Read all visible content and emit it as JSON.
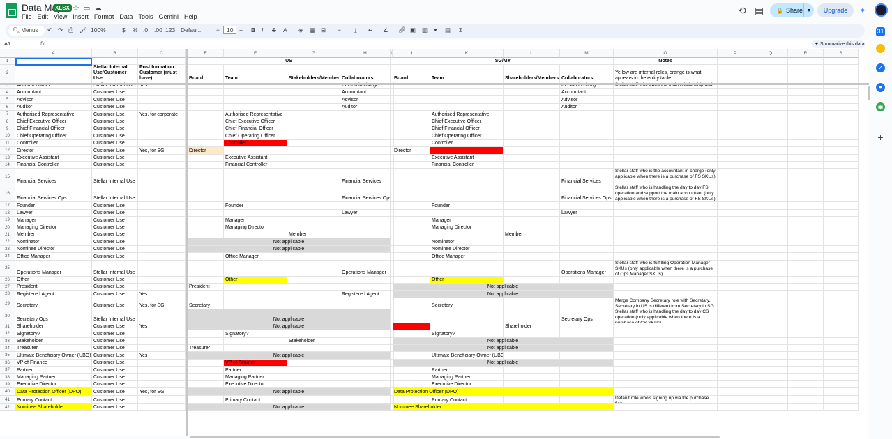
{
  "app": {
    "title": "Data Map",
    "format_badge": "XLSX",
    "menu": [
      "File",
      "Edit",
      "View",
      "Insert",
      "Format",
      "Data",
      "Tools",
      "Gemini",
      "Help"
    ],
    "share_label": "Share",
    "upgrade_label": "Upgrade"
  },
  "toolbar": {
    "menus_label": "Menus",
    "zoom": "100%",
    "currency": "$",
    "percent": "%",
    "dec_dec": ".0",
    "inc_dec": ".00",
    "num_fmt": "123",
    "font": "Defaul...",
    "font_size": "10"
  },
  "formula_bar": {
    "cell_ref": "A1",
    "fx": "fx",
    "summarize_label": "Summarize this data"
  },
  "colors": {
    "red": "#ff0000",
    "yellow": "#ffff00",
    "gray": "#d9d9d9",
    "peach": "#fde9c6",
    "selection": "#1a73e8"
  },
  "columns": [
    "A",
    "B",
    "C",
    "E",
    "F",
    "G",
    "H",
    "I",
    "J",
    "K",
    "L",
    "M",
    "O",
    "P",
    "Q",
    "R",
    "S"
  ],
  "row_numbers": [
    "1",
    "2",
    "3",
    "4",
    "5",
    "6",
    "7",
    "8",
    "9",
    "10",
    "11",
    "12",
    "13",
    "14",
    "15",
    "16",
    "17",
    "18",
    "19",
    "20",
    "21",
    "22",
    "23",
    "24",
    "25",
    "26",
    "27",
    "28",
    "29",
    "30",
    "31",
    "32",
    "33",
    "34",
    "35",
    "36",
    "37",
    "38",
    "39",
    "40",
    "41",
    "42"
  ],
  "headers": {
    "us": "US",
    "sgmy": "SG/MY",
    "notes": "Notes",
    "b2": "Stellar Internal Use/Customer Use",
    "c2": "Post formation Customer (must have)",
    "us_board": "Board",
    "us_team": "Team",
    "us_stake": "Stakeholders/Members",
    "us_collab": "Collaborators",
    "sg_board": "Board",
    "sg_team": "Team",
    "sg_share": "Shareholders/Members",
    "sg_collab": "Collaborators",
    "notes_legend": "Yellow are internal roles, orange is what appears in the entity table"
  },
  "cells": [
    {
      "r": 3,
      "c": "A",
      "t": "Account Owner"
    },
    {
      "r": 3,
      "c": "B",
      "t": "Stellar Internal Use"
    },
    {
      "r": 3,
      "c": "C",
      "t": "Yes"
    },
    {
      "r": 3,
      "c": "H",
      "t": "Person in charge"
    },
    {
      "r": 3,
      "c": "M",
      "t": "Person in charge"
    },
    {
      "r": 3,
      "c": "O",
      "t": "Stellar staff who owns the main relationship and interfaces with the customer",
      "w": 1
    },
    {
      "r": 4,
      "c": "A",
      "t": "Accountant"
    },
    {
      "r": 4,
      "c": "B",
      "t": "Customer Use"
    },
    {
      "r": 4,
      "c": "H",
      "t": "Accountant"
    },
    {
      "r": 4,
      "c": "M",
      "t": "Accountant"
    },
    {
      "r": 5,
      "c": "A",
      "t": "Advisor"
    },
    {
      "r": 5,
      "c": "B",
      "t": "Customer Use"
    },
    {
      "r": 5,
      "c": "H",
      "t": "Advisor"
    },
    {
      "r": 5,
      "c": "M",
      "t": "Advisor"
    },
    {
      "r": 6,
      "c": "A",
      "t": "Auditor"
    },
    {
      "r": 6,
      "c": "B",
      "t": "Customer Use"
    },
    {
      "r": 6,
      "c": "H",
      "t": "Auditor"
    },
    {
      "r": 6,
      "c": "M",
      "t": "Auditor"
    },
    {
      "r": 7,
      "c": "A",
      "t": "Authorised Representative"
    },
    {
      "r": 7,
      "c": "B",
      "t": "Customer Use"
    },
    {
      "r": 7,
      "c": "C",
      "t": "Yes, for corporate"
    },
    {
      "r": 7,
      "c": "F",
      "t": "Authorised Representative"
    },
    {
      "r": 7,
      "c": "K",
      "t": "Authorised Representative"
    },
    {
      "r": 8,
      "c": "A",
      "t": "Chief Executive Officer"
    },
    {
      "r": 8,
      "c": "B",
      "t": "Customer Use"
    },
    {
      "r": 8,
      "c": "F",
      "t": "Chief Executive Officer"
    },
    {
      "r": 8,
      "c": "K",
      "t": "Chief Executive Officer"
    },
    {
      "r": 9,
      "c": "A",
      "t": "Chief Financial Officer"
    },
    {
      "r": 9,
      "c": "B",
      "t": "Customer Use"
    },
    {
      "r": 9,
      "c": "F",
      "t": "Chief Financial Officer"
    },
    {
      "r": 9,
      "c": "K",
      "t": "Chief Financial Officer"
    },
    {
      "r": 10,
      "c": "A",
      "t": "Chief Operating Officer"
    },
    {
      "r": 10,
      "c": "B",
      "t": "Customer Use"
    },
    {
      "r": 10,
      "c": "F",
      "t": "Chief Operating Officer"
    },
    {
      "r": 10,
      "c": "K",
      "t": "Chief Operating Officer"
    },
    {
      "r": 11,
      "c": "A",
      "t": "Controller"
    },
    {
      "r": 11,
      "c": "B",
      "t": "Customer Use"
    },
    {
      "r": 11,
      "c": "F",
      "t": "Controller",
      "bg": "red"
    },
    {
      "r": 11,
      "c": "K",
      "t": "Controller"
    },
    {
      "r": 12,
      "c": "A",
      "t": "Director"
    },
    {
      "r": 12,
      "c": "B",
      "t": "Customer Use"
    },
    {
      "r": 12,
      "c": "C",
      "t": "Yes, for SG"
    },
    {
      "r": 12,
      "c": "E",
      "t": "Director",
      "bg": "peach"
    },
    {
      "r": 12,
      "c": "J",
      "t": "Director"
    },
    {
      "r": 12,
      "c": "K",
      "t": "",
      "bg": "red"
    },
    {
      "r": 13,
      "c": "A",
      "t": "Executive Assistant"
    },
    {
      "r": 13,
      "c": "B",
      "t": "Customer Use"
    },
    {
      "r": 13,
      "c": "F",
      "t": "Executive Assistant"
    },
    {
      "r": 13,
      "c": "K",
      "t": "Executive Assistant"
    },
    {
      "r": 14,
      "c": "A",
      "t": "Financial Controller"
    },
    {
      "r": 14,
      "c": "B",
      "t": "Customer Use"
    },
    {
      "r": 14,
      "c": "F",
      "t": "Financial Controller"
    },
    {
      "r": 14,
      "c": "K",
      "t": "Financial Controller"
    },
    {
      "r": 15,
      "c": "A",
      "t": "Financial Services"
    },
    {
      "r": 15,
      "c": "B",
      "t": "Stellar Internal Use"
    },
    {
      "r": 15,
      "c": "H",
      "t": "Financial Services"
    },
    {
      "r": 15,
      "c": "M",
      "t": "Financial Services"
    },
    {
      "r": 15,
      "c": "O",
      "t": "Stellar staff who is the accountant in charge (only applicable when there is a purchase of FS SKUs)",
      "w": 1
    },
    {
      "r": 16,
      "c": "A",
      "t": "Financial Services Ops"
    },
    {
      "r": 16,
      "c": "B",
      "t": "Stellar Internal Use"
    },
    {
      "r": 16,
      "c": "H",
      "t": "Financial Services Ops"
    },
    {
      "r": 16,
      "c": "M",
      "t": "Financial Services Ops"
    },
    {
      "r": 16,
      "c": "O",
      "t": "Stellar staff who is handling the day to day FS operation and support the main accountant (only applicable when there is a purchase of FS SKUs)",
      "w": 1
    },
    {
      "r": 17,
      "c": "A",
      "t": "Founder"
    },
    {
      "r": 17,
      "c": "B",
      "t": "Customer Use"
    },
    {
      "r": 17,
      "c": "F",
      "t": "Founder"
    },
    {
      "r": 17,
      "c": "K",
      "t": "Founder"
    },
    {
      "r": 18,
      "c": "A",
      "t": "Lawyer"
    },
    {
      "r": 18,
      "c": "B",
      "t": "Customer Use"
    },
    {
      "r": 18,
      "c": "H",
      "t": "Lawyer"
    },
    {
      "r": 18,
      "c": "M",
      "t": "Lawyer"
    },
    {
      "r": 19,
      "c": "A",
      "t": "Manager"
    },
    {
      "r": 19,
      "c": "B",
      "t": "Customer Use"
    },
    {
      "r": 19,
      "c": "F",
      "t": "Manager"
    },
    {
      "r": 19,
      "c": "K",
      "t": "Manager"
    },
    {
      "r": 20,
      "c": "A",
      "t": "Managing Director"
    },
    {
      "r": 20,
      "c": "B",
      "t": "Customer Use"
    },
    {
      "r": 20,
      "c": "F",
      "t": "Managing Director"
    },
    {
      "r": 20,
      "c": "K",
      "t": "Managing Director"
    },
    {
      "r": 21,
      "c": "A",
      "t": "Member"
    },
    {
      "r": 21,
      "c": "B",
      "t": "Customer Use"
    },
    {
      "r": 21,
      "c": "G",
      "t": "Member"
    },
    {
      "r": 21,
      "c": "L",
      "t": "Member"
    },
    {
      "r": 22,
      "c": "A",
      "t": "Nominator"
    },
    {
      "r": 22,
      "c": "B",
      "t": "Customer Use"
    },
    {
      "r": 22,
      "c": "E",
      "t": "Not applicable",
      "bg": "gray",
      "span": "EH",
      "ctr": 1
    },
    {
      "r": 22,
      "c": "K",
      "t": "Nominator"
    },
    {
      "r": 23,
      "c": "A",
      "t": "Nominee Director"
    },
    {
      "r": 23,
      "c": "B",
      "t": "Customer Use"
    },
    {
      "r": 23,
      "c": "E",
      "t": "Not applicable",
      "bg": "gray",
      "span": "EH",
      "ctr": 1
    },
    {
      "r": 23,
      "c": "K",
      "t": "Nominee Director"
    },
    {
      "r": 24,
      "c": "A",
      "t": "Office Manager"
    },
    {
      "r": 24,
      "c": "B",
      "t": "Customer Use"
    },
    {
      "r": 24,
      "c": "F",
      "t": "Office Manager"
    },
    {
      "r": 24,
      "c": "K",
      "t": "Office Manager"
    },
    {
      "r": 25,
      "c": "A",
      "t": "Operations Manager"
    },
    {
      "r": 25,
      "c": "B",
      "t": "Stellar Internal Use"
    },
    {
      "r": 25,
      "c": "H",
      "t": "Operations Manager"
    },
    {
      "r": 25,
      "c": "M",
      "t": "Operations Manager"
    },
    {
      "r": 25,
      "c": "O",
      "t": "Stellar staff who is fulfilling Operation Manager SKUs (only applicable when there is a purchase of Ops Manager SKUs)",
      "w": 1
    },
    {
      "r": 26,
      "c": "A",
      "t": "Other"
    },
    {
      "r": 26,
      "c": "B",
      "t": "Customer Use"
    },
    {
      "r": 26,
      "c": "F",
      "t": "Other",
      "bg": "yellow"
    },
    {
      "r": 26,
      "c": "K",
      "t": "Other",
      "bg": "yellow"
    },
    {
      "r": 27,
      "c": "A",
      "t": "President"
    },
    {
      "r": 27,
      "c": "B",
      "t": "Customer Use"
    },
    {
      "r": 27,
      "c": "E",
      "t": "President"
    },
    {
      "r": 27,
      "c": "J",
      "t": "Not applicable",
      "bg": "gray",
      "span": "JM",
      "ctr": 1
    },
    {
      "r": 28,
      "c": "A",
      "t": "Registered Agent"
    },
    {
      "r": 28,
      "c": "B",
      "t": "Customer Use"
    },
    {
      "r": 28,
      "c": "C",
      "t": "Yes"
    },
    {
      "r": 28,
      "c": "H",
      "t": "Registered Agent"
    },
    {
      "r": 28,
      "c": "J",
      "t": "Not applicable",
      "bg": "gray",
      "span": "JM",
      "ctr": 1
    },
    {
      "r": 29,
      "c": "A",
      "t": "Secretary"
    },
    {
      "r": 29,
      "c": "B",
      "t": "Customer Use"
    },
    {
      "r": 29,
      "c": "C",
      "t": "Yes, for SG"
    },
    {
      "r": 29,
      "c": "E",
      "t": "Secretary"
    },
    {
      "r": 29,
      "c": "K",
      "t": "Secretary"
    },
    {
      "r": 29,
      "c": "O",
      "t": "Merge Company Secretary role with Secretary. Secretary in US is different from Secretary in SG",
      "w": 1
    },
    {
      "r": 30,
      "c": "A",
      "t": "Secretary Ops"
    },
    {
      "r": 30,
      "c": "B",
      "t": "Stellar Internal Use"
    },
    {
      "r": 30,
      "c": "E",
      "t": "Not applicable",
      "bg": "gray",
      "span": "EH",
      "ctr": 1
    },
    {
      "r": 30,
      "c": "M",
      "t": "Secretary Ops"
    },
    {
      "r": 30,
      "c": "O",
      "t": "Stellar staff who is handling the day to day CS operation (only applicable when there is a purchase of CS SKUs)",
      "w": 1
    },
    {
      "r": 31,
      "c": "A",
      "t": "Shareholder"
    },
    {
      "r": 31,
      "c": "B",
      "t": "Customer Use"
    },
    {
      "r": 31,
      "c": "C",
      "t": "Yes"
    },
    {
      "r": 31,
      "c": "E",
      "t": "Not applicable",
      "bg": "gray",
      "span": "EH",
      "ctr": 1
    },
    {
      "r": 31,
      "c": "J",
      "t": "",
      "bg": "red"
    },
    {
      "r": 31,
      "c": "L",
      "t": "Shareholder"
    },
    {
      "r": 32,
      "c": "A",
      "t": "Signatory?"
    },
    {
      "r": 32,
      "c": "B",
      "t": "Customer Use"
    },
    {
      "r": 32,
      "c": "F",
      "t": "Signatory?"
    },
    {
      "r": 32,
      "c": "K",
      "t": "Signatory?"
    },
    {
      "r": 33,
      "c": "A",
      "t": "Stakeholder"
    },
    {
      "r": 33,
      "c": "B",
      "t": "Customer Use"
    },
    {
      "r": 33,
      "c": "G",
      "t": "Stakeholder"
    },
    {
      "r": 33,
      "c": "J",
      "t": "Not applicable",
      "bg": "gray",
      "span": "JM",
      "ctr": 1
    },
    {
      "r": 34,
      "c": "A",
      "t": "Treasurer"
    },
    {
      "r": 34,
      "c": "B",
      "t": "Customer Use"
    },
    {
      "r": 34,
      "c": "E",
      "t": "Treasurer"
    },
    {
      "r": 34,
      "c": "J",
      "t": "Not applicable",
      "bg": "gray",
      "span": "JM",
      "ctr": 1
    },
    {
      "r": 35,
      "c": "A",
      "t": "Ultimate Beneficiary Owner (UBO)"
    },
    {
      "r": 35,
      "c": "B",
      "t": "Customer Use"
    },
    {
      "r": 35,
      "c": "C",
      "t": "Yes"
    },
    {
      "r": 35,
      "c": "E",
      "t": "Not applicable",
      "bg": "gray",
      "span": "EH",
      "ctr": 1
    },
    {
      "r": 35,
      "c": "K",
      "t": "Ultimate Beneficiary Owner (UBO)"
    },
    {
      "r": 36,
      "c": "A",
      "t": "VP of Finance"
    },
    {
      "r": 36,
      "c": "B",
      "t": "Customer Use"
    },
    {
      "r": 36,
      "c": "F",
      "t": "VP of Finance",
      "bg": "red"
    },
    {
      "r": 36,
      "c": "J",
      "t": "Not applicable",
      "bg": "gray",
      "span": "JM",
      "ctr": 1
    },
    {
      "r": 37,
      "c": "A",
      "t": "Partner"
    },
    {
      "r": 37,
      "c": "B",
      "t": "Customer Use"
    },
    {
      "r": 37,
      "c": "F",
      "t": "Partner"
    },
    {
      "r": 37,
      "c": "K",
      "t": "Partner"
    },
    {
      "r": 38,
      "c": "A",
      "t": "Managing Partner"
    },
    {
      "r": 38,
      "c": "B",
      "t": "Customer Use"
    },
    {
      "r": 38,
      "c": "F",
      "t": "Managing Partner"
    },
    {
      "r": 38,
      "c": "K",
      "t": "Managing Partner"
    },
    {
      "r": 39,
      "c": "A",
      "t": "Executive Director"
    },
    {
      "r": 39,
      "c": "B",
      "t": "Customer Use"
    },
    {
      "r": 39,
      "c": "F",
      "t": "Executive Director"
    },
    {
      "r": 39,
      "c": "K",
      "t": "Executive Director"
    },
    {
      "r": 40,
      "c": "A",
      "t": "Data Protection Officer (DPO)",
      "bg": "yellow"
    },
    {
      "r": 40,
      "c": "B",
      "t": "Customer Use"
    },
    {
      "r": 40,
      "c": "C",
      "t": "Yes, for SG"
    },
    {
      "r": 40,
      "c": "E",
      "t": "Not applicable",
      "bg": "gray",
      "span": "EH",
      "ctr": 1
    },
    {
      "r": 40,
      "c": "J",
      "t": "Data Protection Officer (DPO)",
      "bg": "yellow",
      "span": "JM"
    },
    {
      "r": 41,
      "c": "A",
      "t": "Primary Contact"
    },
    {
      "r": 41,
      "c": "B",
      "t": "Customer Use"
    },
    {
      "r": 41,
      "c": "F",
      "t": "Primary Contact"
    },
    {
      "r": 41,
      "c": "K",
      "t": "Primary Contact"
    },
    {
      "r": 41,
      "c": "O",
      "t": "Default role who's signing up via the purchase flow",
      "w": 1
    },
    {
      "r": 42,
      "c": "A",
      "t": "Nominee Shareholder",
      "bg": "yellow"
    },
    {
      "r": 42,
      "c": "B",
      "t": "Customer Use"
    },
    {
      "r": 42,
      "c": "E",
      "t": "Not applicable",
      "bg": "gray",
      "span": "EH",
      "ctr": 1
    },
    {
      "r": 42,
      "c": "J",
      "t": "Nominee Shareholder",
      "bg": "yellow",
      "span": "JM"
    }
  ]
}
